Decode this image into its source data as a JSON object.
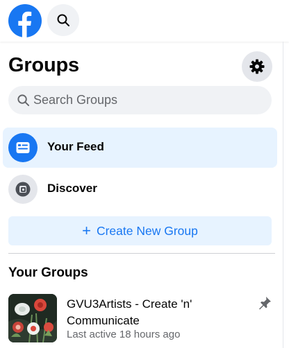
{
  "header": {
    "logo_icon": "facebook-logo-icon",
    "search_icon": "search-icon"
  },
  "groups": {
    "title": "Groups",
    "settings_icon": "gear-icon",
    "search": {
      "placeholder": "Search Groups",
      "value": ""
    },
    "nav": [
      {
        "label": "Your Feed",
        "icon": "feed-icon",
        "active": true
      },
      {
        "label": "Discover",
        "icon": "discover-icon",
        "active": false
      }
    ],
    "create": {
      "plus": "+",
      "label": "Create New Group"
    },
    "your_groups": {
      "title": "Your Groups",
      "items": [
        {
          "name": "GVU3Artists - Create 'n' Communicate",
          "meta": "Last active 18 hours ago",
          "pinned": true
        }
      ]
    }
  },
  "colors": {
    "brand": "#1877f2",
    "active_bg": "#e7f3ff",
    "surface": "#f0f2f5",
    "secondary_text": "#65676b"
  }
}
